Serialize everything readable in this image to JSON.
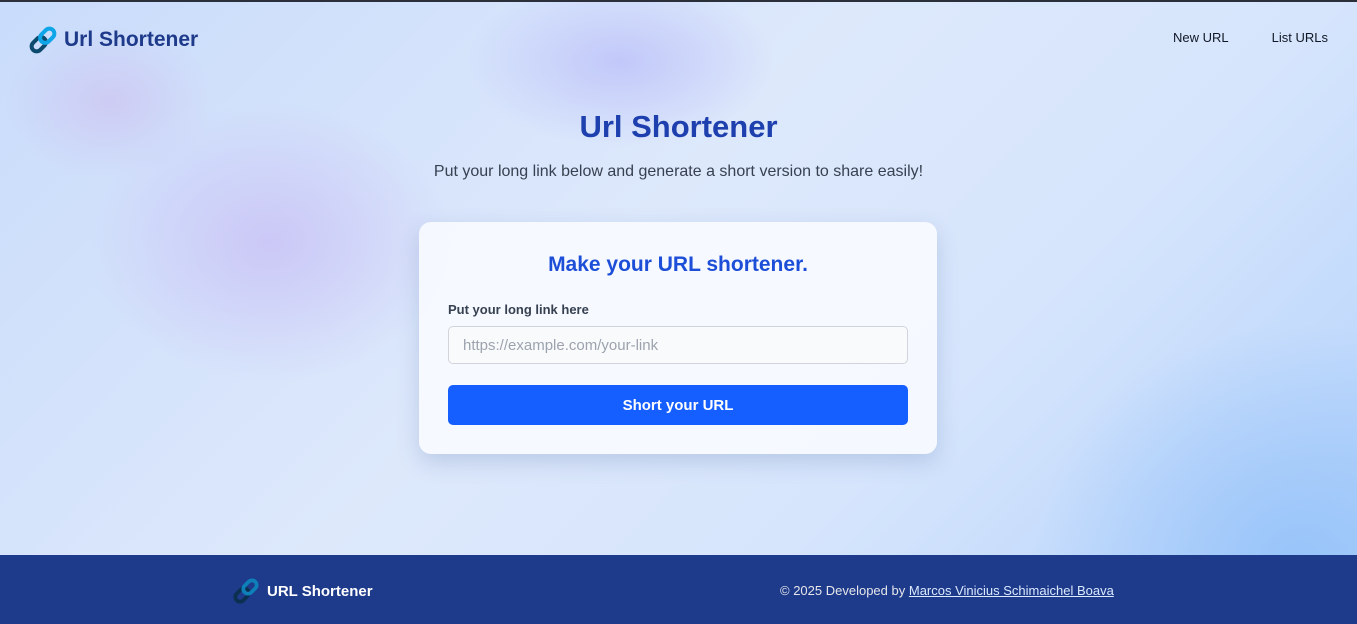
{
  "header": {
    "logo_icon": "link-icon",
    "logo_text": "Url Shortener",
    "nav": [
      {
        "label": "New URL"
      },
      {
        "label": "List URLs"
      }
    ]
  },
  "hero": {
    "title": "Url Shortener",
    "subtitle": "Put your long link below and generate a short version to share easily!"
  },
  "form": {
    "title": "Make your URL shortener.",
    "field_label": "Put your long link here",
    "input_value": "",
    "input_placeholder": "https://example.com/your-link",
    "submit_label": "Short your URL"
  },
  "footer": {
    "logo_icon": "link-icon",
    "logo_text": "URL Shortener",
    "copyright_prefix": "© 2025 Developed by",
    "author_link": "Marcos Vinicius Schimaichel Boava"
  },
  "colors": {
    "brand_dark": "#1e3a8a",
    "heading_blue": "#1e40af",
    "accent_blue": "#155eff"
  }
}
